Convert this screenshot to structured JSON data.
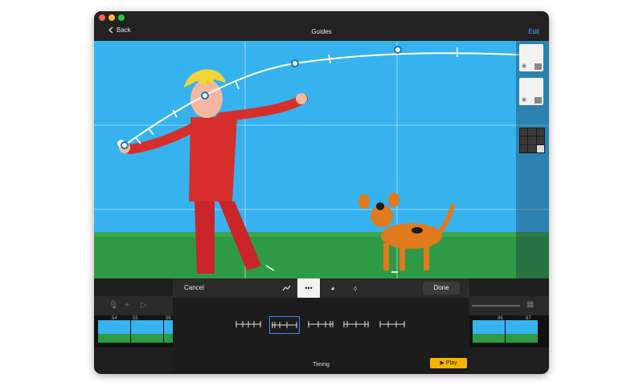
{
  "window": {
    "traffic_lights": [
      "#ff5f57",
      "#febc2e",
      "#28c840"
    ],
    "back_label": "Back",
    "title": "Guides",
    "edit_label": "Edit"
  },
  "timeline": {
    "frame_numbers": [
      "54",
      "55",
      "56",
      "86",
      "87"
    ]
  },
  "guide_popover": {
    "cancel_label": "Cancel",
    "done_label": "Done",
    "modes": [
      {
        "name": "path-mode",
        "icon": "path-curve-icon"
      },
      {
        "name": "spacing-mode",
        "icon": "dots-icon",
        "active": true
      },
      {
        "name": "color-mode",
        "icon": "palette-icon"
      },
      {
        "name": "ink-mode",
        "icon": "drop-icon"
      }
    ],
    "spacing_presets": [
      {
        "name": "even"
      },
      {
        "name": "ease-in",
        "selected": true
      },
      {
        "name": "ease-out"
      },
      {
        "name": "ease-both"
      },
      {
        "name": "linear-sparse"
      }
    ],
    "section_label": "Timing",
    "play_label": "▶ Play"
  },
  "colors": {
    "sky": "#36b3ee",
    "accent": "#4aa3ff",
    "play": "#f3b600"
  }
}
